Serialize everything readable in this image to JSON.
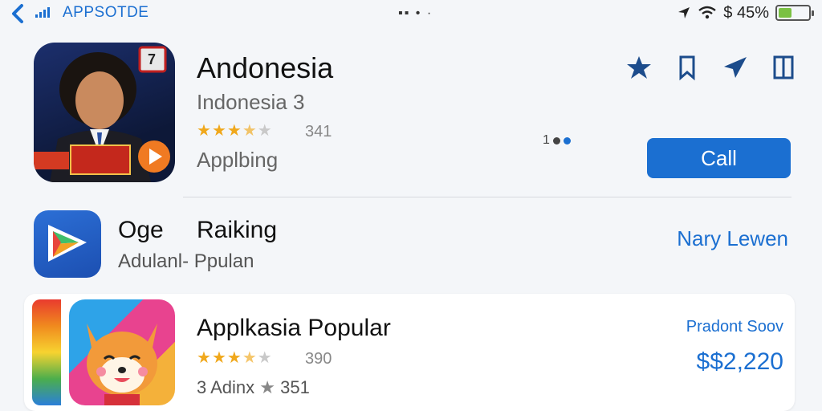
{
  "status_bar": {
    "carrier": "APPSOTDE",
    "notch": "▪▪ • ·",
    "battery_text": "$ 45%",
    "battery_level": 0.45,
    "accent_color": "#1b6fd1"
  },
  "featured_app": {
    "title": "Andonesia",
    "subtitle": "Indonesia  3",
    "rating_stars": 3.5,
    "rating_count": "341",
    "category": "Applbing",
    "icon_badge": "7",
    "action_button": "Call",
    "pager_text": "1",
    "actions": [
      "star-icon",
      "bookmark-icon",
      "plane-icon",
      "book-icon"
    ]
  },
  "row2": {
    "name_a": "Oge",
    "name_b": "Raiking",
    "subtitle": "Adulanl- Ppulan",
    "link": "Nary Lewen"
  },
  "row3": {
    "title": "Applkasia Popular",
    "rating_stars": 3.5,
    "rating_count": "390",
    "sub_label": "3 Adinx",
    "sub_count": "351",
    "price_label": "Pradont Soov",
    "price": "$$2,220"
  }
}
